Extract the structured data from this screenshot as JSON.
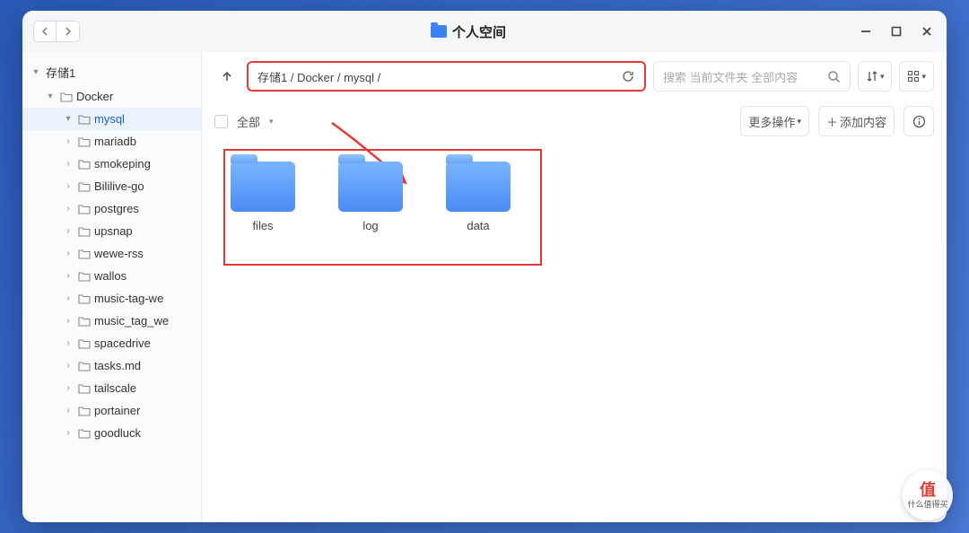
{
  "window": {
    "title": "个人空间"
  },
  "breadcrumb": "存储1 / Docker / mysql /",
  "search": {
    "placeholder": "搜索 当前文件夹 全部内容"
  },
  "toolbar": {
    "select_all": "全部",
    "more_ops": "更多操作",
    "add_content": "添加内容"
  },
  "sidebar": {
    "root": "存储1",
    "items": [
      {
        "label": "Docker",
        "expanded": true,
        "level": 1
      },
      {
        "label": "mysql",
        "expanded": true,
        "level": 2,
        "selected": true
      },
      {
        "label": "mariadb",
        "level": 2
      },
      {
        "label": "smokeping",
        "level": 2
      },
      {
        "label": "Bililive-go",
        "level": 2
      },
      {
        "label": "postgres",
        "level": 2
      },
      {
        "label": "upsnap",
        "level": 2
      },
      {
        "label": "wewe-rss",
        "level": 2
      },
      {
        "label": "wallos",
        "level": 2
      },
      {
        "label": "music-tag-we",
        "level": 2
      },
      {
        "label": "music_tag_we",
        "level": 2
      },
      {
        "label": "spacedrive",
        "level": 2
      },
      {
        "label": "tasks.md",
        "level": 2
      },
      {
        "label": "tailscale",
        "level": 2
      },
      {
        "label": "portainer",
        "level": 2
      },
      {
        "label": "goodluck",
        "level": 2
      }
    ]
  },
  "folders": [
    {
      "name": "files"
    },
    {
      "name": "log"
    },
    {
      "name": "data"
    }
  ],
  "watermark": {
    "char": "值",
    "text": "什么值得买"
  }
}
